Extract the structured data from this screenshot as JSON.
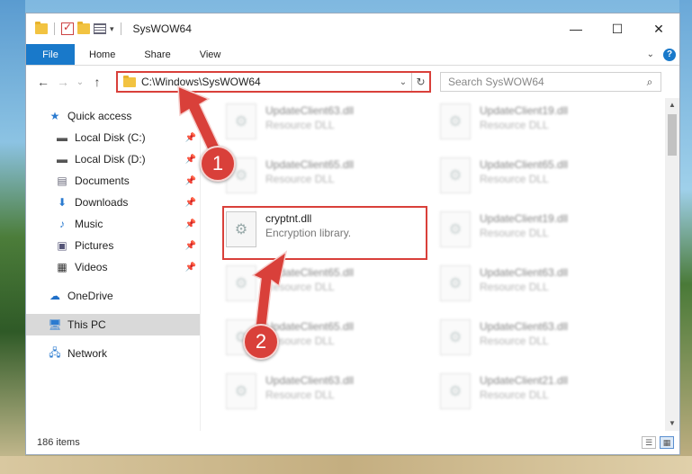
{
  "window": {
    "title": "SysWOW64",
    "quick_access_dropdown": "▾"
  },
  "ribbon": {
    "file": "File",
    "tabs": [
      "Home",
      "Share",
      "View"
    ],
    "help": "?"
  },
  "address": {
    "path": "C:\\Windows\\SysWOW64",
    "search_placeholder": "Search SysWOW64"
  },
  "sidebar": {
    "quick_access": "Quick access",
    "pinned": [
      {
        "label": "Local Disk (C:)",
        "icon": "drive-icon"
      },
      {
        "label": "Local Disk (D:)",
        "icon": "drive-icon"
      },
      {
        "label": "Documents",
        "icon": "documents-icon"
      },
      {
        "label": "Downloads",
        "icon": "downloads-icon"
      },
      {
        "label": "Music",
        "icon": "music-icon"
      },
      {
        "label": "Pictures",
        "icon": "pictures-icon"
      },
      {
        "label": "Videos",
        "icon": "videos-icon"
      }
    ],
    "onedrive": "OneDrive",
    "this_pc": "This PC",
    "network": "Network"
  },
  "files": {
    "left_column": [
      {
        "name": "UpdateClient63.dll",
        "desc": "Resource DLL"
      },
      {
        "name": "UpdateClient65.dll",
        "desc": "Resource DLL"
      },
      {
        "name": "cryptnt.dll",
        "desc": "Encryption library."
      },
      {
        "name": "UpdateClient65.dll",
        "desc": "Resource DLL"
      },
      {
        "name": "UpdateClient65.dll",
        "desc": "Resource DLL"
      },
      {
        "name": "UpdateClient63.dll",
        "desc": "Resource DLL"
      }
    ],
    "right_column": [
      {
        "name": "UpdateClient19.dll",
        "desc": "Resource DLL"
      },
      {
        "name": "UpdateClient65.dll",
        "desc": "Resource DLL"
      },
      {
        "name": "UpdateClient19.dll",
        "desc": "Resource DLL"
      },
      {
        "name": "UpdateClient63.dll",
        "desc": "Resource DLL"
      },
      {
        "name": "UpdateClient63.dll",
        "desc": "Resource DLL"
      },
      {
        "name": "UpdateClient21.dll",
        "desc": "Resource DLL"
      }
    ]
  },
  "status": {
    "count": "186 items"
  },
  "annotations": {
    "step1": "1",
    "step2": "2",
    "color": "#d9403a"
  }
}
